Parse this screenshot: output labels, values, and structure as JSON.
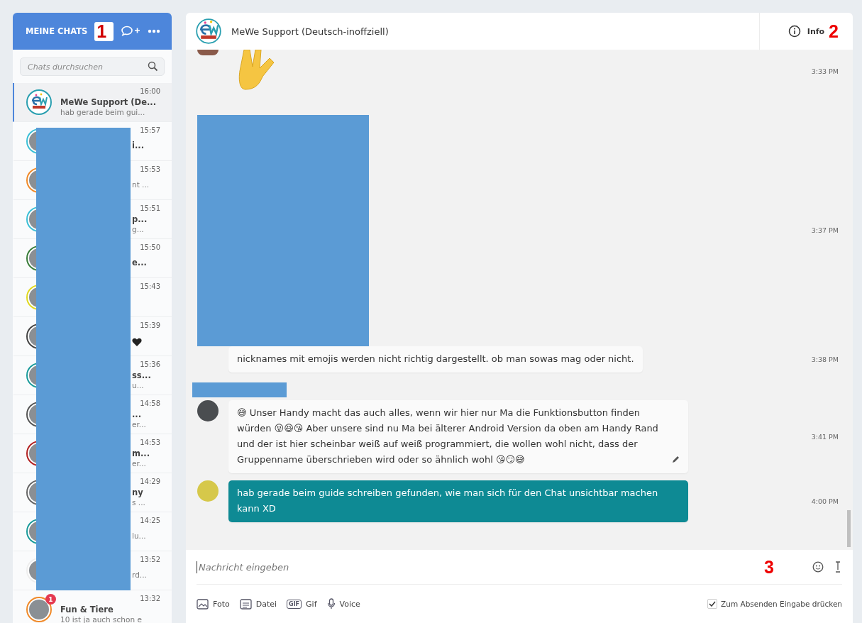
{
  "sidebar": {
    "title": "MEINE CHATS",
    "annotation": "1",
    "search": {
      "placeholder": "Chats durchsuchen"
    },
    "chats": [
      {
        "kind": "logo",
        "name": "MeWe Support (De...",
        "preview": "hab gerade beim gui...",
        "time": "16:00",
        "selected": true,
        "color": "#2a9fb0"
      },
      {
        "kind": "redacted",
        "name": "i...",
        "time": "15:57",
        "selected": false,
        "color": "#3bbfd6"
      },
      {
        "kind": "redacted",
        "preview": "nt ...",
        "time": "15:53",
        "selected": false,
        "color": "#f08a2a"
      },
      {
        "kind": "redacted",
        "name": "p...",
        "preview": "g...",
        "time": "15:51",
        "selected": false,
        "color": "#3bbfd6"
      },
      {
        "kind": "redacted",
        "name": "e...",
        "time": "15:50",
        "selected": false,
        "color": "#3a7d3a"
      },
      {
        "kind": "redacted",
        "time": "15:43",
        "selected": false,
        "color": "#e0d820"
      },
      {
        "kind": "redacted",
        "heart": true,
        "time": "15:39",
        "selected": false,
        "color": "#444444"
      },
      {
        "kind": "redacted",
        "name": "ss...",
        "preview": "u...",
        "time": "15:36",
        "selected": false,
        "color": "#1a9b9b"
      },
      {
        "kind": "redacted",
        "name": "...",
        "preview": "er...",
        "time": "14:58",
        "selected": false,
        "color": "#555555"
      },
      {
        "kind": "redacted",
        "name": "m...",
        "preview": "er...",
        "time": "14:53",
        "selected": false,
        "color": "#b22222"
      },
      {
        "kind": "redacted",
        "name": "ny",
        "preview": "s ...",
        "time": "14:29",
        "selected": false,
        "color": "#666666"
      },
      {
        "kind": "redacted",
        "preview": "lu...",
        "time": "14:25",
        "selected": false,
        "color": "#1a9b9b"
      },
      {
        "kind": "redacted",
        "preview": "rd...",
        "time": "13:52",
        "selected": false,
        "color": "#eeeeee"
      },
      {
        "kind": "photo",
        "name": "Fun & Tiere",
        "preview": "10 ist ja auch schon e",
        "time": "13:32",
        "selected": false,
        "color": "#f08a2a",
        "badge": "1"
      }
    ]
  },
  "chat": {
    "title": "MeWe Support (Deutsch-inoffziell)",
    "info": "Info",
    "annotation": "2",
    "messages": [
      {
        "kind": "emoji",
        "time": "3:33 PM"
      },
      {
        "kind": "hidden",
        "time": "3:37 PM"
      },
      {
        "kind": "text",
        "own": false,
        "text": "nicknames mit emojis werden nicht richtig dargestellt. ob man sowas mag oder nicht.",
        "time": "3:38 PM"
      },
      {
        "kind": "text",
        "own": false,
        "sender_hidden": true,
        "avatar": true,
        "edited": true,
        "text": "😅 Unser Handy macht das auch alles, wenn wir hier nur Ma die Funktionsbutton finden würden 😜😆😘 Aber unsere sind nu Ma bei älterer Android Version da oben am Handy Rand und der ist hier scheinbar weiß auf weiß programmiert, die wollen wohl nicht, dass der Gruppenname überschrieben wird oder so ähnlich wohl 😘😏😅",
        "time": "3:41 PM"
      },
      {
        "kind": "text",
        "own": true,
        "avatar": true,
        "text": "hab gerade beim guide schreiben gefunden, wie man sich für den Chat unsichtbar machen kann XD",
        "time": "4:00 PM"
      }
    ]
  },
  "composer": {
    "placeholder": "Nachricht eingeben",
    "annotation": "3",
    "tools": [
      {
        "kind": "photo",
        "label": "Foto"
      },
      {
        "kind": "file",
        "label": "Datei"
      },
      {
        "kind": "gif",
        "label": "Gif",
        "icon_text": "GIF"
      },
      {
        "kind": "voice",
        "label": "Voice"
      }
    ],
    "enter_to_send": {
      "label": "Zum Absenden Eingabe drücken",
      "checked": true
    }
  }
}
